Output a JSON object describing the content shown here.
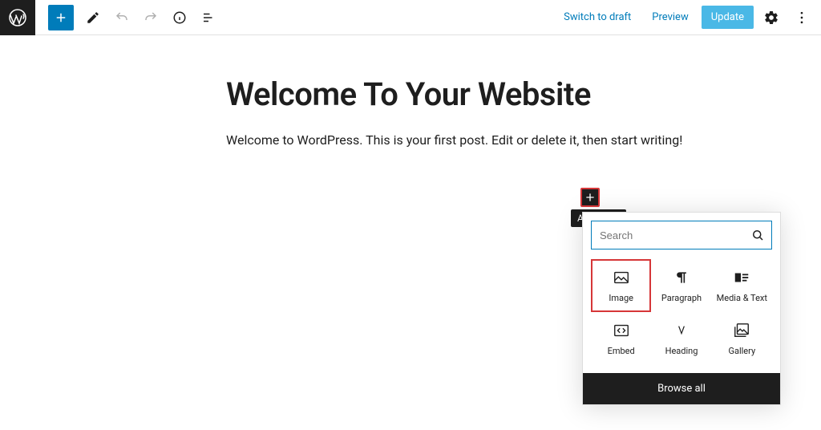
{
  "toolbar": {
    "switch_draft": "Switch to draft",
    "preview": "Preview",
    "update": "Update"
  },
  "post": {
    "title": "Welcome To Your Website",
    "body": "Welcome to WordPress. This is your first post. Edit or delete it, then start writing!"
  },
  "inserter": {
    "tooltip": "Add block",
    "search_placeholder": "Search",
    "blocks": {
      "image": "Image",
      "paragraph": "Paragraph",
      "media_text": "Media & Text",
      "embed": "Embed",
      "heading": "Heading",
      "gallery": "Gallery"
    },
    "browse_all": "Browse all"
  }
}
